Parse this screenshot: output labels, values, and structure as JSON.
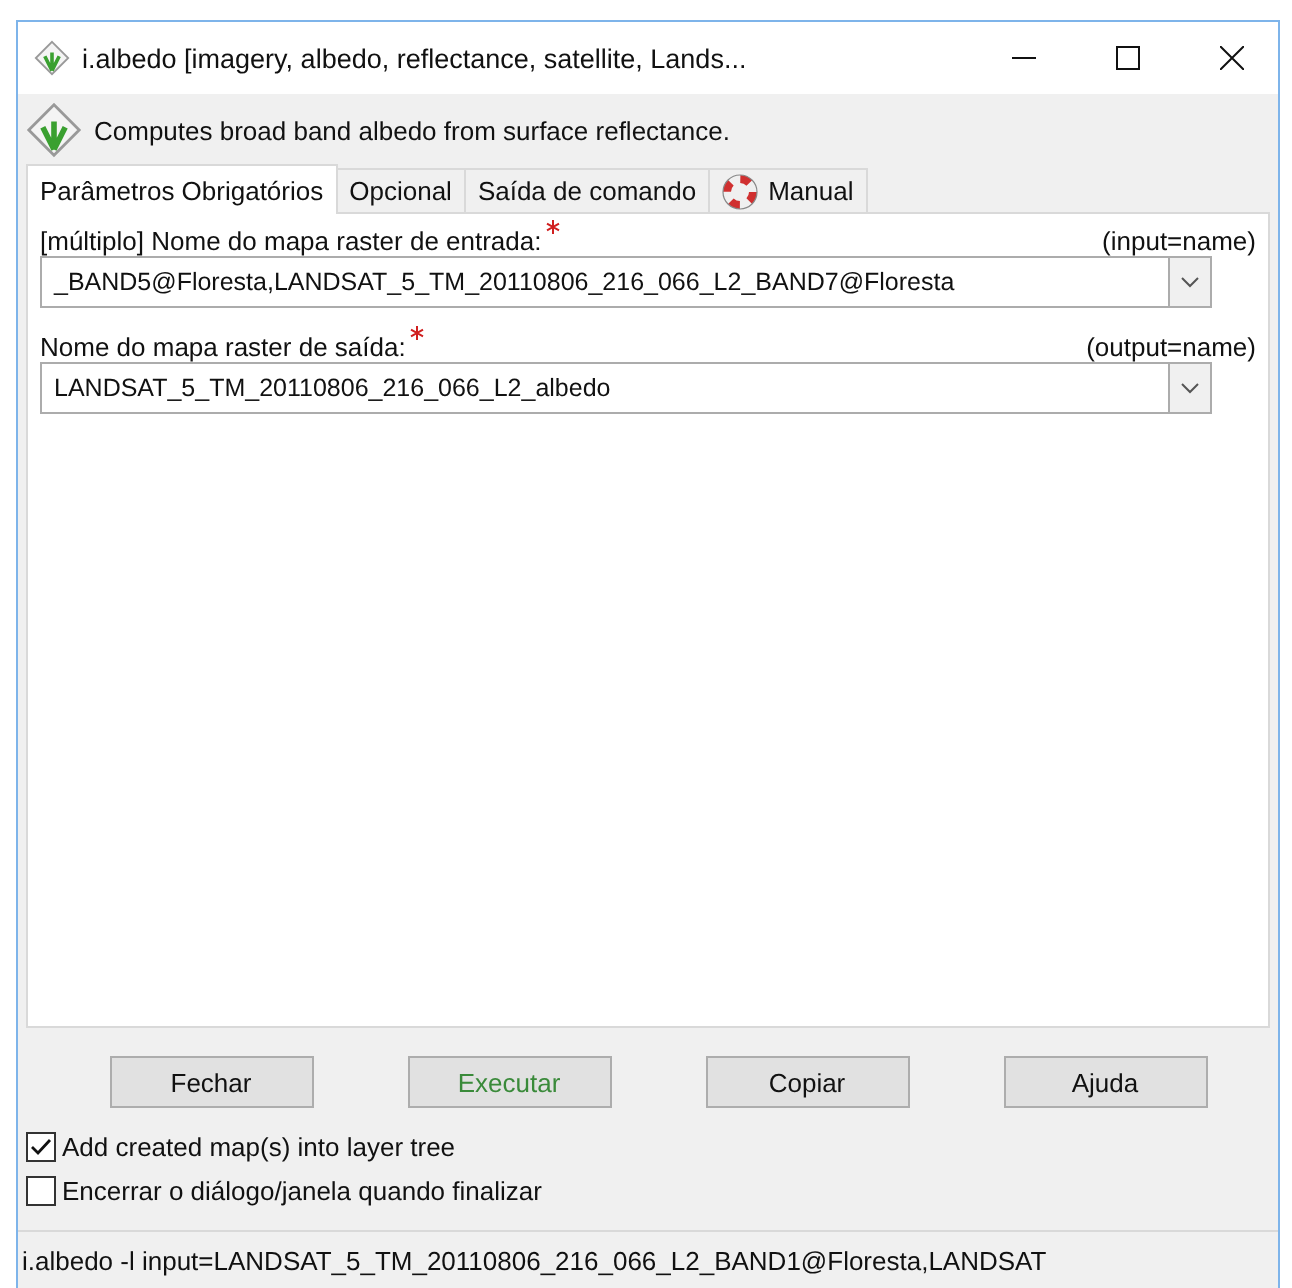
{
  "window": {
    "title": "i.albedo [imagery, albedo, reflectance, satellite, Lands..."
  },
  "description": "Computes broad band albedo from surface reflectance.",
  "tabs": [
    {
      "label": "Parâmetros Obrigatórios",
      "selected": true,
      "kind": "plain"
    },
    {
      "label": "Opcional",
      "selected": false,
      "kind": "plain"
    },
    {
      "label": "Saída de comando",
      "selected": false,
      "kind": "plain"
    },
    {
      "label": "Manual",
      "selected": false,
      "kind": "help"
    }
  ],
  "fields": [
    {
      "label": "[múltiplo] Nome do mapa raster de entrada:",
      "required": true,
      "param": "(input=name)",
      "value": "_BAND5@Floresta,LANDSAT_5_TM_20110806_216_066_L2_BAND7@Floresta"
    },
    {
      "label": "Nome do mapa raster de saída:",
      "required": true,
      "param": "(output=name)",
      "value": "LANDSAT_5_TM_20110806_216_066_L2_albedo"
    }
  ],
  "buttons": [
    {
      "label": "Fechar",
      "kind": "normal"
    },
    {
      "label": "Executar",
      "kind": "primary"
    },
    {
      "label": "Copiar",
      "kind": "normal"
    },
    {
      "label": "Ajuda",
      "kind": "normal"
    }
  ],
  "options": [
    {
      "label": "Add created map(s) into layer tree",
      "checked": true
    },
    {
      "label": "Encerrar o diálogo/janela quando finalizar",
      "checked": false
    }
  ],
  "status_bar": "i.albedo -l input=LANDSAT_5_TM_20110806_216_066_L2_BAND1@Floresta,LANDSAT"
}
